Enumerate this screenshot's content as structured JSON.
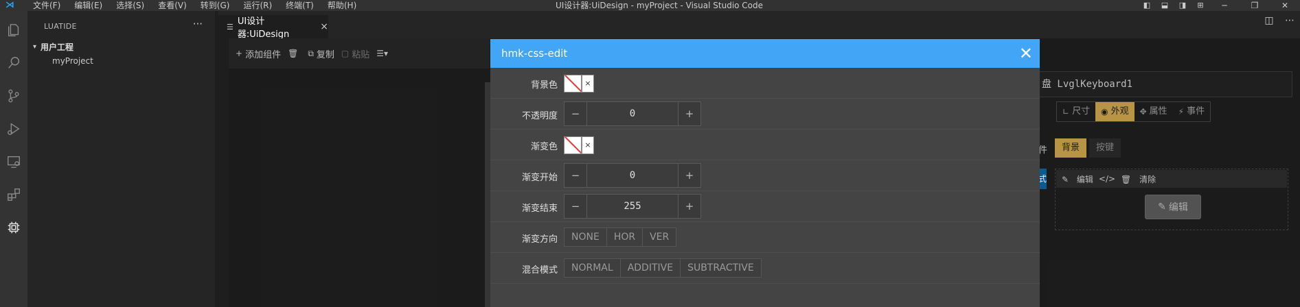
{
  "titlebar": {
    "menus": [
      "文件(F)",
      "编辑(E)",
      "选择(S)",
      "查看(V)",
      "转到(G)",
      "运行(R)",
      "终端(T)",
      "帮助(H)"
    ],
    "window_title": "UI设计器:UiDesign - myProject - Visual Studio Code"
  },
  "sidebar": {
    "title": "LUATIDE",
    "more": "···",
    "tree": {
      "root": "用户工程",
      "child": "myProject"
    }
  },
  "editor": {
    "tab_label": "UI设计器:UiDesign",
    "tab_close": "×"
  },
  "designer_toolbar": {
    "add_component": "添加组件",
    "copy": "复制",
    "paste": "粘贴"
  },
  "right_panel": {
    "component_name": "盘 LvglKeyboard1",
    "tabs": [
      {
        "icon": "∟",
        "label": "尺寸"
      },
      {
        "icon": "◉",
        "label": "外观"
      },
      {
        "icon": "✥",
        "label": "属性"
      },
      {
        "icon": "⚡",
        "label": "事件"
      }
    ],
    "active_tab": "外观",
    "sub_left": "件",
    "sub_tabs": [
      "背景",
      "按键"
    ],
    "active_sub_tab": "背景",
    "style_edge": "式",
    "style_edit": "编辑",
    "style_clear": "清除",
    "edit_button": "编辑"
  },
  "dialog": {
    "title": "hmk-css-edit",
    "close": "✕",
    "rows": {
      "bg_color": {
        "label": "背景色",
        "value": "",
        "clear": "×"
      },
      "opacity": {
        "label": "不透明度",
        "value": "0",
        "minus": "−",
        "plus": "+"
      },
      "grad_color": {
        "label": "渐变色",
        "value": "",
        "clear": "×"
      },
      "grad_start": {
        "label": "渐变开始",
        "value": "0",
        "minus": "−",
        "plus": "+"
      },
      "grad_end": {
        "label": "渐变结束",
        "value": "255",
        "minus": "−",
        "plus": "+"
      },
      "grad_dir": {
        "label": "渐变方向",
        "options": [
          "NONE",
          "HOR",
          "VER"
        ]
      },
      "blend_mode": {
        "label": "混合模式",
        "options": [
          "NORMAL",
          "ADDITIVE",
          "SUBTRACTIVE"
        ]
      }
    }
  },
  "colors": {
    "accent": "#42a5f5",
    "active_tab": "#c8a24a",
    "vs_blue": "#23a9f2"
  }
}
